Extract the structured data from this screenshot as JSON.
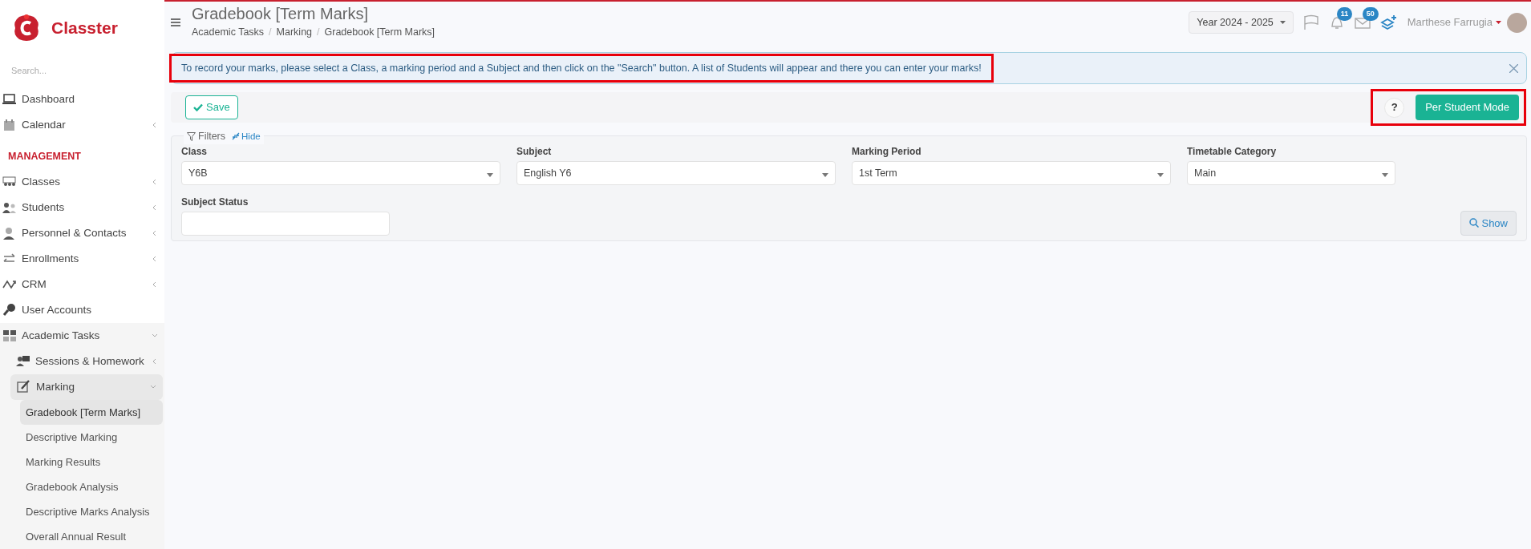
{
  "brand": {
    "name": "Classter"
  },
  "sidebar": {
    "search_placeholder": "Search...",
    "sections": [
      {
        "items": [
          {
            "label": "Dashboard",
            "expandable": false,
            "expanded": false,
            "selected": false
          },
          {
            "label": "Calendar",
            "expandable": true,
            "expanded": false,
            "selected": false
          }
        ]
      },
      {
        "heading": "MANAGEMENT",
        "items": [
          {
            "label": "Classes",
            "expandable": true,
            "expanded": false,
            "selected": false
          },
          {
            "label": "Students",
            "expandable": true,
            "expanded": false,
            "selected": false
          },
          {
            "label": "Personnel & Contacts",
            "expandable": true,
            "expanded": false,
            "selected": false
          },
          {
            "label": "Enrollments",
            "expandable": true,
            "expanded": false,
            "selected": false
          },
          {
            "label": "CRM",
            "expandable": true,
            "expanded": false,
            "selected": false
          },
          {
            "label": "User Accounts",
            "expandable": false,
            "expanded": false,
            "selected": false
          },
          {
            "label": "Academic Tasks",
            "expandable": true,
            "expanded": true,
            "selected": false,
            "children": [
              {
                "label": "Sessions & Homework",
                "expandable": true,
                "expanded": false,
                "selected": false
              },
              {
                "label": "Marking",
                "expandable": true,
                "expanded": true,
                "selected": false,
                "children": [
                  {
                    "label": "Gradebook [Term Marks]",
                    "expandable": false,
                    "expanded": false,
                    "selected": true
                  },
                  {
                    "label": "Descriptive Marking",
                    "expandable": false,
                    "expanded": false,
                    "selected": false
                  },
                  {
                    "label": "Marking Results",
                    "expandable": false,
                    "expanded": false,
                    "selected": false
                  },
                  {
                    "label": "Gradebook Analysis",
                    "expandable": false,
                    "expanded": false,
                    "selected": false
                  },
                  {
                    "label": "Descriptive Marks Analysis",
                    "expandable": false,
                    "expanded": false,
                    "selected": false
                  },
                  {
                    "label": "Overall Annual Result",
                    "expandable": false,
                    "expanded": false,
                    "selected": false
                  }
                ]
              }
            ]
          }
        ]
      }
    ]
  },
  "header": {
    "title": "Gradebook [Term Marks]",
    "breadcrumb": [
      "Academic Tasks",
      "Marking",
      "Gradebook [Term Marks]"
    ],
    "breadcrumb_separator": "/",
    "year": "Year 2024 - 2025",
    "notifications_count": "11",
    "messages_count": "50",
    "user": "Marthese Farrugia"
  },
  "alert": {
    "text": "To record your marks, please select a Class, a marking period and a Subject and then click on the \"Search\" button. A list of Students will appear and there you can enter your marks!",
    "highlighted": true
  },
  "toolbar": {
    "save": "Save",
    "help": "?",
    "mode_button": "Per Student Mode",
    "actions_highlighted": true
  },
  "filters": {
    "legend": "Filters",
    "toggle": "Hide",
    "fields": [
      {
        "label": "Class",
        "kind": "select",
        "value": "Y6B"
      },
      {
        "label": "Subject",
        "kind": "select",
        "value": "English Y6"
      },
      {
        "label": "Marking Period",
        "kind": "select",
        "value": "1st Term"
      },
      {
        "label": "Timetable Category",
        "kind": "select",
        "value": "Main"
      },
      {
        "label": "Subject Status",
        "kind": "input"
      }
    ],
    "show_button": "Show"
  }
}
